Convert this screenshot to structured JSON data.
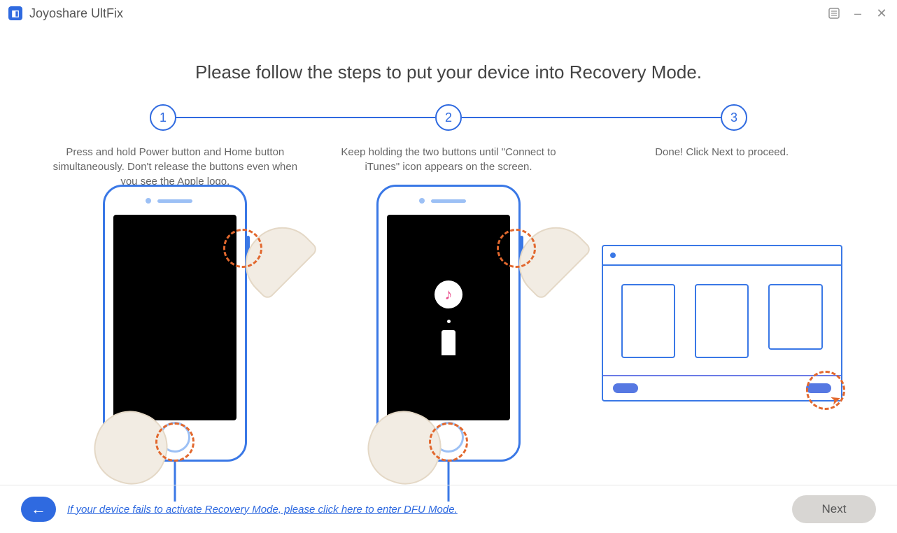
{
  "app": {
    "name": "Joyoshare UltFix"
  },
  "headline": "Please follow the steps to put your device into Recovery Mode.",
  "steps": {
    "s1": {
      "num": "1",
      "desc": "Press and hold Power button and Home button simultaneously. Don't release the buttons even when you see the Apple logo."
    },
    "s2": {
      "num": "2",
      "desc": "Keep holding the two buttons until \"Connect to iTunes\" icon appears on the screen."
    },
    "s3": {
      "num": "3",
      "desc": "Done! Click Next to proceed."
    }
  },
  "bottom": {
    "dfu_link": "If your device fails to activate Recovery Mode, please click here to enter DFU Mode.",
    "next": "Next"
  }
}
